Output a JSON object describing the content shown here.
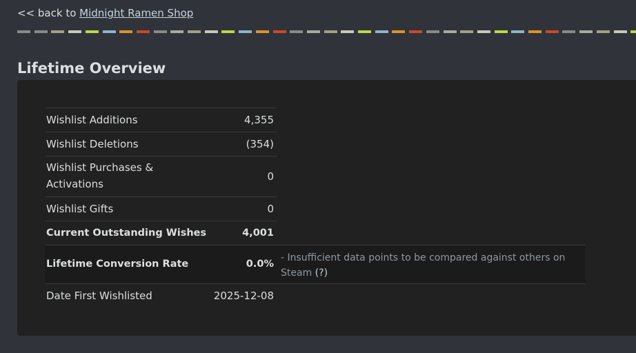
{
  "nav": {
    "back_prefix": "<< back to",
    "back_link": "Midnight Ramen Shop"
  },
  "page_title": "Lifetime Overview",
  "rows": [
    {
      "label": "Wishlist Additions",
      "value": "4,355"
    },
    {
      "label": "Wishlist Deletions",
      "value": "(354)"
    },
    {
      "label": "Wishlist Purchases & Activations",
      "value": "0"
    },
    {
      "label": "Wishlist Gifts",
      "value": "0"
    },
    {
      "label": "Current Outstanding Wishes",
      "value": "4,001"
    },
    {
      "label": "Lifetime Conversion Rate",
      "value": "0.0%",
      "note": "- Insufficient data points to be compared against others on Steam",
      "help": "(?)"
    },
    {
      "label": "Date First Wishlisted",
      "value": "2025-12-08"
    }
  ],
  "colors": {
    "background": "#30333a",
    "panel": "#212121",
    "stripe": [
      "#8a8a88",
      "#8a8a88",
      "#a3a08a",
      "#c9c8b5",
      "#b9d944",
      "#8fb4c9",
      "#d8942e",
      "#c84a2a",
      "#8a8a88",
      "#a9aaa0",
      "#a3a08a",
      "#c9c8b5",
      "#b9d944",
      "#8fb4c9",
      "#d8942e",
      "#c84a2a",
      "#8a8a88",
      "#a9aaa0",
      "#a3a08a",
      "#c9c8b5",
      "#b9d944",
      "#8fb4c9",
      "#d8942e",
      "#c84a2a",
      "#8a8a88",
      "#a9aaa0",
      "#a3a08a",
      "#c9c8b5",
      "#b9d944",
      "#8fb4c9",
      "#d8942e",
      "#c84a2a",
      "#8a8a88",
      "#a9aaa0",
      "#a3a08a",
      "#c9c8b5",
      "#b9d944"
    ]
  }
}
